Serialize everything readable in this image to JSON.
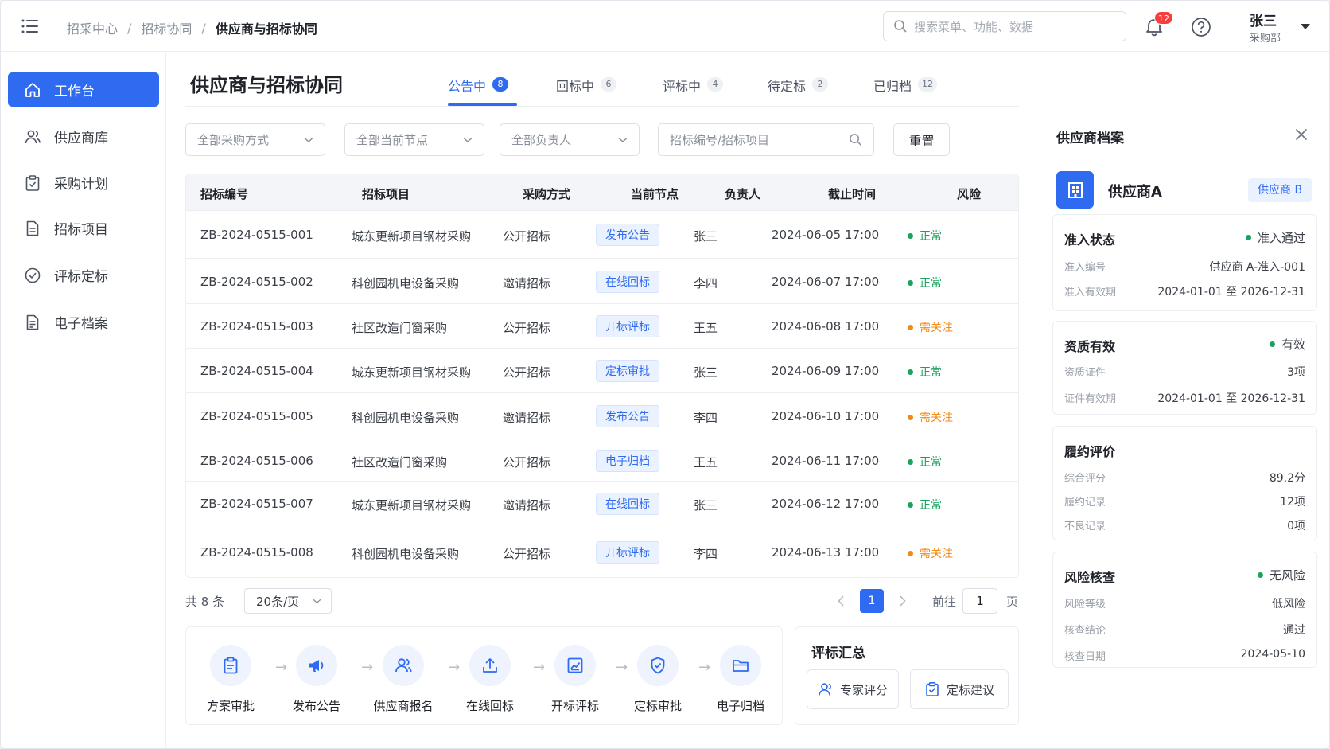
{
  "colors": {
    "accent": "#2f6bf0",
    "ok": "#1aa35c",
    "warn": "#f28a1a",
    "danger": "#f53f3f"
  },
  "header": {
    "breadcrumbs": [
      "招采中心",
      "招标协同",
      "供应商与招标协同"
    ],
    "breadcrumb_sep": "/",
    "search_placeholder": "搜索菜单、功能、数据",
    "notification_count": "12",
    "user_name": "张三",
    "user_dept": "采购部"
  },
  "sidebar": {
    "items": [
      {
        "label": "工作台",
        "icon": "home-icon"
      },
      {
        "label": "供应商库",
        "icon": "users-icon"
      },
      {
        "label": "采购计划",
        "icon": "clipboard-check-icon"
      },
      {
        "label": "招标项目",
        "icon": "document-icon"
      },
      {
        "label": "评标定标",
        "icon": "check-circle-icon"
      },
      {
        "label": "电子档案",
        "icon": "file-archive-icon"
      }
    ]
  },
  "main": {
    "title": "供应商与招标协同",
    "tabs": [
      {
        "label": "公告中",
        "count": "8"
      },
      {
        "label": "回标中",
        "count": "6"
      },
      {
        "label": "评标中",
        "count": "4"
      },
      {
        "label": "待定标",
        "count": "2"
      },
      {
        "label": "已归档",
        "count": "12"
      }
    ],
    "filters": {
      "method": "全部采购方式",
      "node": "全部当前节点",
      "owner": "全部负责人",
      "search_placeholder": "招标编号/招标项目",
      "reset": "重置"
    },
    "table": {
      "columns": [
        "招标编号",
        "招标项目",
        "采购方式",
        "当前节点",
        "负责人",
        "截止时间",
        "风险"
      ],
      "rows": [
        {
          "code": "ZB-2024-0515-001",
          "project": "城东更新项目钢材采购",
          "method": "公开招标",
          "node": "发布公告",
          "owner": "张三",
          "deadline": "2024-06-05 17:00",
          "risk": "正常",
          "risk_level": "ok"
        },
        {
          "code": "ZB-2024-0515-002",
          "project": "科创园机电设备采购",
          "method": "邀请招标",
          "node": "在线回标",
          "owner": "李四",
          "deadline": "2024-06-07 17:00",
          "risk": "正常",
          "risk_level": "ok"
        },
        {
          "code": "ZB-2024-0515-003",
          "project": "社区改造门窗采购",
          "method": "公开招标",
          "node": "开标评标",
          "owner": "王五",
          "deadline": "2024-06-08 17:00",
          "risk": "需关注",
          "risk_level": "warn"
        },
        {
          "code": "ZB-2024-0515-004",
          "project": "城东更新项目钢材采购",
          "method": "公开招标",
          "node": "定标审批",
          "owner": "张三",
          "deadline": "2024-06-09 17:00",
          "risk": "正常",
          "risk_level": "ok"
        },
        {
          "code": "ZB-2024-0515-005",
          "project": "科创园机电设备采购",
          "method": "邀请招标",
          "node": "发布公告",
          "owner": "李四",
          "deadline": "2024-06-10 17:00",
          "risk": "需关注",
          "risk_level": "warn"
        },
        {
          "code": "ZB-2024-0515-006",
          "project": "社区改造门窗采购",
          "method": "公开招标",
          "node": "电子归档",
          "owner": "王五",
          "deadline": "2024-06-11 17:00",
          "risk": "正常",
          "risk_level": "ok"
        },
        {
          "code": "ZB-2024-0515-007",
          "project": "城东更新项目钢材采购",
          "method": "邀请招标",
          "node": "在线回标",
          "owner": "张三",
          "deadline": "2024-06-12 17:00",
          "risk": "正常",
          "risk_level": "ok"
        },
        {
          "code": "ZB-2024-0515-008",
          "project": "科创园机电设备采购",
          "method": "公开招标",
          "node": "开标评标",
          "owner": "李四",
          "deadline": "2024-06-13 17:00",
          "risk": "需关注",
          "risk_level": "warn"
        }
      ]
    },
    "pagination": {
      "total": "共 8 条",
      "page_size": "20条/页",
      "current_page": "1",
      "goto_label": "前往",
      "goto_value": "1",
      "page_suffix": "页"
    },
    "flow": {
      "steps": [
        {
          "label": "方案审批",
          "icon": "clipboard-icon"
        },
        {
          "label": "发布公告",
          "icon": "megaphone-icon"
        },
        {
          "label": "供应商报名",
          "icon": "users-icon"
        },
        {
          "label": "在线回标",
          "icon": "upload-icon"
        },
        {
          "label": "开标评标",
          "icon": "chart-icon"
        },
        {
          "label": "定标审批",
          "icon": "shield-check-icon"
        },
        {
          "label": "电子归档",
          "icon": "folder-icon"
        }
      ]
    },
    "summary": {
      "title": "评标汇总",
      "expert_btn": "专家评分",
      "suggest_btn": "定标建议"
    }
  },
  "panel": {
    "title": "供应商档案",
    "supplier_name": "供应商A",
    "supplier_tag": "供应商 B",
    "admission": {
      "title": "准入状态",
      "status": "准入通过",
      "rows": [
        {
          "label": "准入编号",
          "value": "供应商 A-准入-001"
        },
        {
          "label": "准入有效期",
          "value": "2024-01-01 至 2026-12-31"
        }
      ]
    },
    "qualification": {
      "title": "资质有效",
      "status": "有效",
      "rows": [
        {
          "label": "资质证件",
          "value": "3项"
        },
        {
          "label": "证件有效期",
          "value": "2024-01-01 至 2026-12-31"
        }
      ]
    },
    "performance": {
      "title": "履约评价",
      "rows": [
        {
          "label": "综合评分",
          "value": "89.2分"
        },
        {
          "label": "履约记录",
          "value": "12项"
        },
        {
          "label": "不良记录",
          "value": "0项"
        }
      ]
    },
    "risk": {
      "title": "风险核查",
      "status": "无风险",
      "rows": [
        {
          "label": "风险等级",
          "value": "低风险"
        },
        {
          "label": "核查结论",
          "value": "通过"
        },
        {
          "label": "核查日期",
          "value": "2024-05-10"
        }
      ]
    }
  }
}
